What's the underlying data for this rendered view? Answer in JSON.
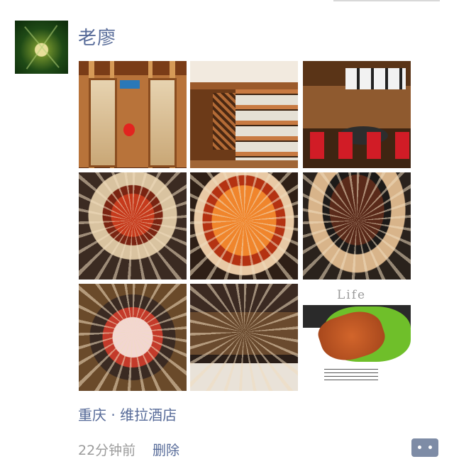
{
  "post": {
    "username": "老廖",
    "location": "重庆 · 维拉酒店",
    "time": "22分钟前",
    "delete_label": "删除",
    "photo_text": "Life"
  },
  "icons": {
    "comment": "comment-bubble-icon",
    "avatar": "avatar-plant-photo"
  },
  "colors": {
    "link": "#566a98",
    "meta": "#9b9b9b",
    "comment_btn": "#7e8ca6"
  },
  "photos": [
    "restaurant-entrance-photo",
    "wine-shelf-photo",
    "dining-room-photo",
    "bbq-grill-photo-1",
    "bbq-grill-photo-2",
    "bbq-grill-photo-3",
    "bbq-grill-photo-4",
    "bbq-grill-photo-5",
    "grilled-meat-poster-photo"
  ]
}
